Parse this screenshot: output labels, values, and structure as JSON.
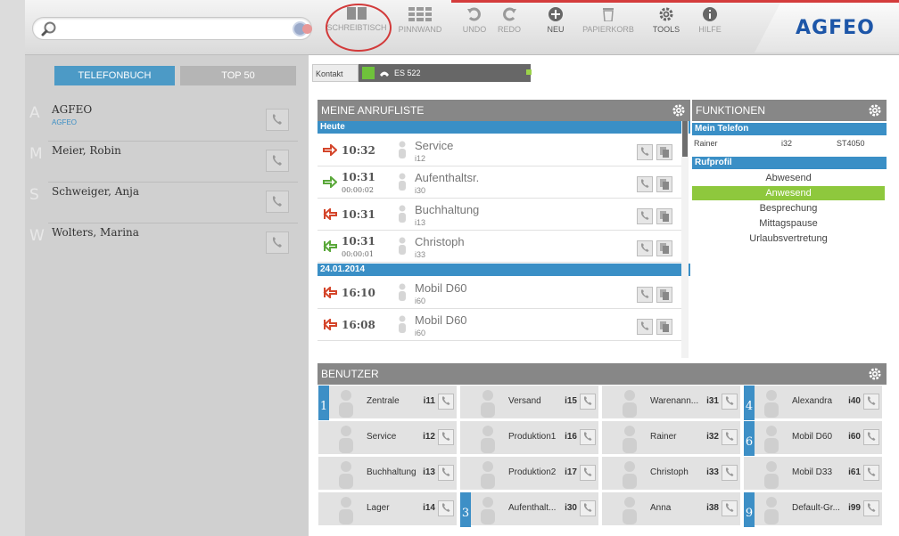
{
  "toolbar": {
    "search_placeholder": "",
    "schreibtisch": "SCHREIBTISCH",
    "pinnwand": "PINNWAND",
    "undo": "UNDO",
    "redo": "REDO",
    "neu": "NEU",
    "papierkorb": "PAPIERKORB",
    "tools": "TOOLS",
    "hilfe": "HILFE",
    "logo": "AGFEO"
  },
  "phonebook": {
    "tabs": [
      "TELEFONBUCH",
      "TOP 50"
    ],
    "contacts": [
      {
        "letter": "A",
        "name": "AGFEO",
        "sub": "AGFEO"
      },
      {
        "letter": "M",
        "name": "Meier, Robin",
        "sub": ""
      },
      {
        "letter": "S",
        "name": "Schweiger, Anja",
        "sub": ""
      },
      {
        "letter": "W",
        "name": "Wolters, Marina",
        "sub": ""
      }
    ]
  },
  "kontakt": {
    "label": "Kontakt",
    "device": "ES 522"
  },
  "anrufliste": {
    "title": "MEINE ANRUFLISTE",
    "sections": [
      {
        "label": "Heute"
      },
      {
        "label": "24.01.2014"
      }
    ],
    "calls": [
      {
        "dir": "out",
        "time": "10:32",
        "dur": "",
        "name": "Service",
        "num": "i12"
      },
      {
        "dir": "in",
        "time": "10:31",
        "dur": "00:00:02",
        "name": "Aufenthaltsr.",
        "num": "i30"
      },
      {
        "dir": "missed",
        "time": "10:31",
        "dur": "",
        "name": "Buchhaltung",
        "num": "i13"
      },
      {
        "dir": "in",
        "time": "10:31",
        "dur": "00:00:01",
        "name": "Christoph",
        "num": "i33"
      },
      {
        "dir": "missed",
        "time": "16:10",
        "dur": "",
        "name": "Mobil D60",
        "num": "i60"
      },
      {
        "dir": "missed",
        "time": "16:08",
        "dur": "",
        "name": "Mobil D60",
        "num": "i60"
      }
    ]
  },
  "funktionen": {
    "title": "FUNKTIONEN",
    "mein_telefon": "Mein Telefon",
    "phone": {
      "user": "Rainer",
      "ext": "i32",
      "model": "ST4050"
    },
    "rufprofil": "Rufprofil",
    "profiles": [
      "Abwesend",
      "Anwesend",
      "Besprechung",
      "Mittagspause",
      "Urlaubsvertretung"
    ],
    "active_profile": "Anwesend"
  },
  "benutzer": {
    "title": "BENUTZER",
    "users": [
      {
        "name": "Zentrale",
        "num": "i11",
        "group": "1"
      },
      {
        "name": "Versand",
        "num": "i15",
        "group": ""
      },
      {
        "name": "Warenann...",
        "num": "i31",
        "group": ""
      },
      {
        "name": "Alexandra",
        "num": "i40",
        "group": "4"
      },
      {
        "name": "Service",
        "num": "i12",
        "group": ""
      },
      {
        "name": "Produktion1",
        "num": "i16",
        "group": ""
      },
      {
        "name": "Rainer",
        "num": "i32",
        "group": ""
      },
      {
        "name": "Mobil D60",
        "num": "i60",
        "group": "6"
      },
      {
        "name": "Buchhaltung",
        "num": "i13",
        "group": ""
      },
      {
        "name": "Produktion2",
        "num": "i17",
        "group": ""
      },
      {
        "name": "Christoph",
        "num": "i33",
        "group": ""
      },
      {
        "name": "Mobil D33",
        "num": "i61",
        "group": ""
      },
      {
        "name": "Lager",
        "num": "i14",
        "group": ""
      },
      {
        "name": "Aufenthalt...",
        "num": "i30",
        "group": "3"
      },
      {
        "name": "Anna",
        "num": "i38",
        "group": ""
      },
      {
        "name": "Default-Gr...",
        "num": "i99",
        "group": "9"
      }
    ]
  },
  "colors": {
    "accent_blue": "#3a8fc6",
    "active_green": "#8ec83d",
    "brand_blue": "#1d56a8",
    "highlight_ring": "#d23a3a"
  }
}
